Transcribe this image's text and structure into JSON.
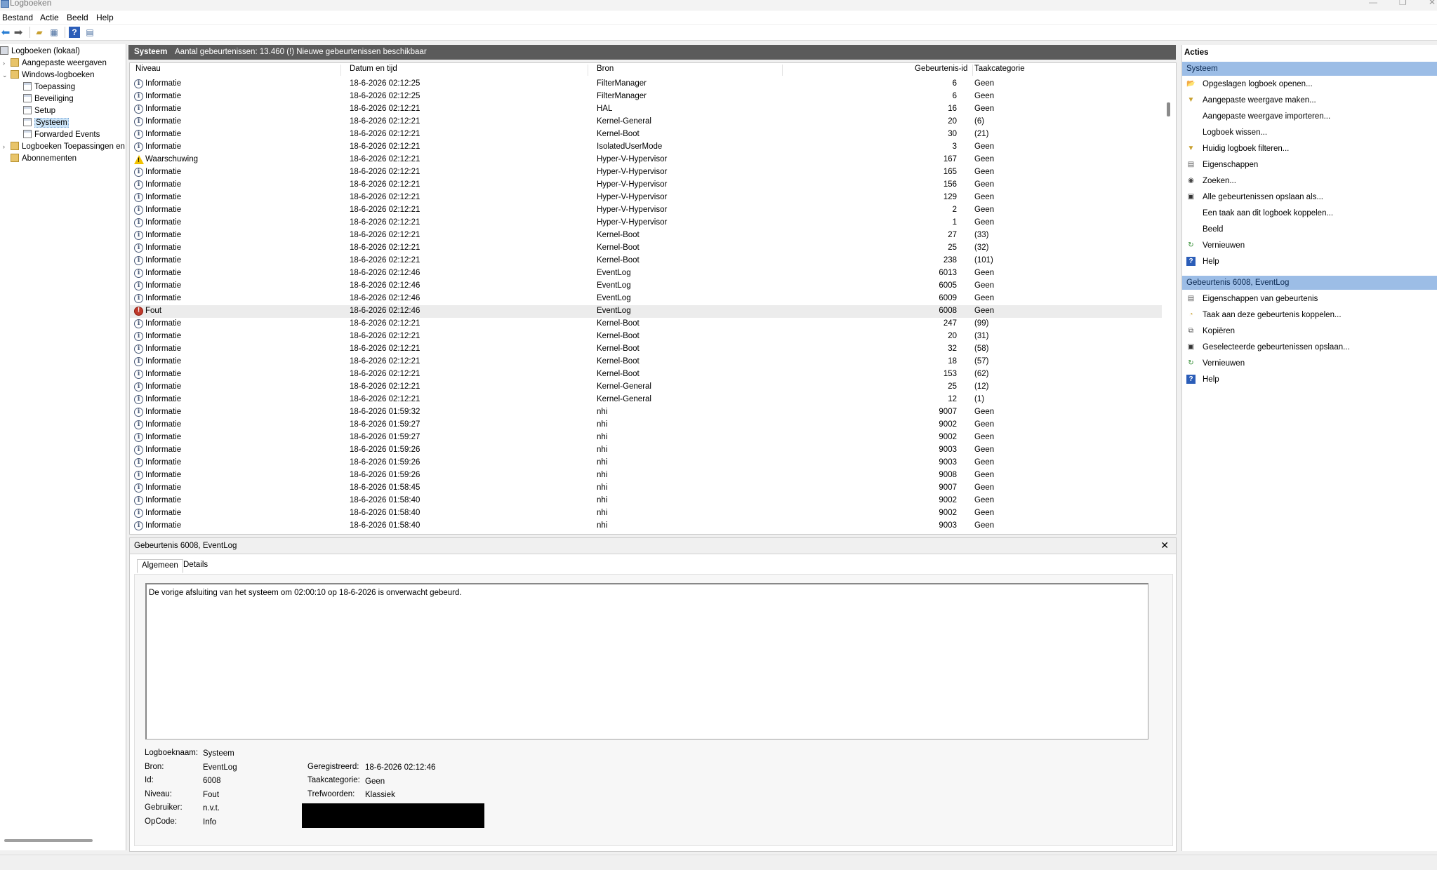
{
  "window": {
    "title": "Logboeken"
  },
  "menu": [
    "Bestand",
    "Actie",
    "Beeld",
    "Help"
  ],
  "toolbar": [
    "back-icon",
    "forward-icon",
    "up-folder-icon",
    "show-hide-tree-icon",
    "help-icon",
    "show-hide-actions-icon"
  ],
  "tree": {
    "root": "Logboeken (lokaal)",
    "custom_views": "Aangepaste weergaven",
    "windows_logs": "Windows-logboeken",
    "logs": [
      "Toepassing",
      "Beveiliging",
      "Setup",
      "Systeem",
      "Forwarded Events"
    ],
    "app_logs": "Logboeken Toepassingen en",
    "subscriptions": "Abonnementen"
  },
  "center": {
    "log_name": "Systeem",
    "count_text": "Aantal gebeurtenissen: 13.460 (!) Nieuwe gebeurtenissen beschikbaar",
    "columns": [
      "Niveau",
      "Datum en tijd",
      "Bron",
      "Gebeurtenis-id",
      "Taakcategorie"
    ]
  },
  "events": [
    {
      "level": "Informatie",
      "type": "info",
      "date": "18-6-2026 02:12:25",
      "source": "FilterManager",
      "id": "6",
      "cat": "Geen"
    },
    {
      "level": "Informatie",
      "type": "info",
      "date": "18-6-2026 02:12:25",
      "source": "FilterManager",
      "id": "6",
      "cat": "Geen"
    },
    {
      "level": "Informatie",
      "type": "info",
      "date": "18-6-2026 02:12:21",
      "source": "HAL",
      "id": "16",
      "cat": "Geen"
    },
    {
      "level": "Informatie",
      "type": "info",
      "date": "18-6-2026 02:12:21",
      "source": "Kernel-General",
      "id": "20",
      "cat": "(6)"
    },
    {
      "level": "Informatie",
      "type": "info",
      "date": "18-6-2026 02:12:21",
      "source": "Kernel-Boot",
      "id": "30",
      "cat": "(21)"
    },
    {
      "level": "Informatie",
      "type": "info",
      "date": "18-6-2026 02:12:21",
      "source": "IsolatedUserMode",
      "id": "3",
      "cat": "Geen"
    },
    {
      "level": "Waarschuwing",
      "type": "warn",
      "date": "18-6-2026 02:12:21",
      "source": "Hyper-V-Hypervisor",
      "id": "167",
      "cat": "Geen"
    },
    {
      "level": "Informatie",
      "type": "info",
      "date": "18-6-2026 02:12:21",
      "source": "Hyper-V-Hypervisor",
      "id": "165",
      "cat": "Geen"
    },
    {
      "level": "Informatie",
      "type": "info",
      "date": "18-6-2026 02:12:21",
      "source": "Hyper-V-Hypervisor",
      "id": "156",
      "cat": "Geen"
    },
    {
      "level": "Informatie",
      "type": "info",
      "date": "18-6-2026 02:12:21",
      "source": "Hyper-V-Hypervisor",
      "id": "129",
      "cat": "Geen"
    },
    {
      "level": "Informatie",
      "type": "info",
      "date": "18-6-2026 02:12:21",
      "source": "Hyper-V-Hypervisor",
      "id": "2",
      "cat": "Geen"
    },
    {
      "level": "Informatie",
      "type": "info",
      "date": "18-6-2026 02:12:21",
      "source": "Hyper-V-Hypervisor",
      "id": "1",
      "cat": "Geen"
    },
    {
      "level": "Informatie",
      "type": "info",
      "date": "18-6-2026 02:12:21",
      "source": "Kernel-Boot",
      "id": "27",
      "cat": "(33)"
    },
    {
      "level": "Informatie",
      "type": "info",
      "date": "18-6-2026 02:12:21",
      "source": "Kernel-Boot",
      "id": "25",
      "cat": "(32)"
    },
    {
      "level": "Informatie",
      "type": "info",
      "date": "18-6-2026 02:12:21",
      "source": "Kernel-Boot",
      "id": "238",
      "cat": "(101)"
    },
    {
      "level": "Informatie",
      "type": "info",
      "date": "18-6-2026 02:12:46",
      "source": "EventLog",
      "id": "6013",
      "cat": "Geen"
    },
    {
      "level": "Informatie",
      "type": "info",
      "date": "18-6-2026 02:12:46",
      "source": "EventLog",
      "id": "6005",
      "cat": "Geen"
    },
    {
      "level": "Informatie",
      "type": "info",
      "date": "18-6-2026 02:12:46",
      "source": "EventLog",
      "id": "6009",
      "cat": "Geen"
    },
    {
      "level": "Fout",
      "type": "err",
      "date": "18-6-2026 02:12:46",
      "source": "EventLog",
      "id": "6008",
      "cat": "Geen",
      "selected": true
    },
    {
      "level": "Informatie",
      "type": "info",
      "date": "18-6-2026 02:12:21",
      "source": "Kernel-Boot",
      "id": "247",
      "cat": "(99)"
    },
    {
      "level": "Informatie",
      "type": "info",
      "date": "18-6-2026 02:12:21",
      "source": "Kernel-Boot",
      "id": "20",
      "cat": "(31)"
    },
    {
      "level": "Informatie",
      "type": "info",
      "date": "18-6-2026 02:12:21",
      "source": "Kernel-Boot",
      "id": "32",
      "cat": "(58)"
    },
    {
      "level": "Informatie",
      "type": "info",
      "date": "18-6-2026 02:12:21",
      "source": "Kernel-Boot",
      "id": "18",
      "cat": "(57)"
    },
    {
      "level": "Informatie",
      "type": "info",
      "date": "18-6-2026 02:12:21",
      "source": "Kernel-Boot",
      "id": "153",
      "cat": "(62)"
    },
    {
      "level": "Informatie",
      "type": "info",
      "date": "18-6-2026 02:12:21",
      "source": "Kernel-General",
      "id": "25",
      "cat": "(12)"
    },
    {
      "level": "Informatie",
      "type": "info",
      "date": "18-6-2026 02:12:21",
      "source": "Kernel-General",
      "id": "12",
      "cat": "(1)"
    },
    {
      "level": "Informatie",
      "type": "info",
      "date": "18-6-2026 01:59:32",
      "source": "nhi",
      "id": "9007",
      "cat": "Geen"
    },
    {
      "level": "Informatie",
      "type": "info",
      "date": "18-6-2026 01:59:27",
      "source": "nhi",
      "id": "9002",
      "cat": "Geen"
    },
    {
      "level": "Informatie",
      "type": "info",
      "date": "18-6-2026 01:59:27",
      "source": "nhi",
      "id": "9002",
      "cat": "Geen"
    },
    {
      "level": "Informatie",
      "type": "info",
      "date": "18-6-2026 01:59:26",
      "source": "nhi",
      "id": "9003",
      "cat": "Geen"
    },
    {
      "level": "Informatie",
      "type": "info",
      "date": "18-6-2026 01:59:26",
      "source": "nhi",
      "id": "9003",
      "cat": "Geen"
    },
    {
      "level": "Informatie",
      "type": "info",
      "date": "18-6-2026 01:59:26",
      "source": "nhi",
      "id": "9008",
      "cat": "Geen"
    },
    {
      "level": "Informatie",
      "type": "info",
      "date": "18-6-2026 01:58:45",
      "source": "nhi",
      "id": "9007",
      "cat": "Geen"
    },
    {
      "level": "Informatie",
      "type": "info",
      "date": "18-6-2026 01:58:40",
      "source": "nhi",
      "id": "9002",
      "cat": "Geen"
    },
    {
      "level": "Informatie",
      "type": "info",
      "date": "18-6-2026 01:58:40",
      "source": "nhi",
      "id": "9002",
      "cat": "Geen"
    },
    {
      "level": "Informatie",
      "type": "info",
      "date": "18-6-2026 01:58:40",
      "source": "nhi",
      "id": "9003",
      "cat": "Geen"
    }
  ],
  "detail": {
    "title": "Gebeurtenis 6008, EventLog",
    "close": "✕",
    "tabs": [
      "Algemeen",
      "Details"
    ],
    "description": "De vorige afsluiting van het systeem om 02:00:10 op 18-6-2026 is onverwacht gebeurd.",
    "fields": {
      "logboeknaam_label": "Logboeknaam:",
      "logboeknaam": "Systeem",
      "bron_label": "Bron:",
      "bron": "EventLog",
      "id_label": "Id:",
      "id": "6008",
      "niveau_label": "Niveau:",
      "niveau": "Fout",
      "gebruiker_label": "Gebruiker:",
      "gebruiker": "n.v.t.",
      "opcode_label": "OpCode:",
      "opcode": "Info",
      "geregistreerd_label": "Geregistreerd:",
      "geregistreerd": "18-6-2026 02:12:46",
      "taakcategorie_label": "Taakcategorie:",
      "taakcategorie": "Geen",
      "trefwoorden_label": "Trefwoorden:",
      "trefwoorden": "Klassiek"
    }
  },
  "actions": {
    "title": "Acties",
    "section1": "Systeem",
    "items1": [
      {
        "label": "Opgeslagen logboek openen...",
        "icon": "folder-open-icon"
      },
      {
        "label": "Aangepaste weergave maken...",
        "icon": "filter-icon"
      },
      {
        "label": "Aangepaste weergave importeren...",
        "icon": ""
      },
      {
        "label": "Logboek wissen...",
        "icon": ""
      },
      {
        "label": "Huidig logboek filteren...",
        "icon": "filter-icon"
      },
      {
        "label": "Eigenschappen",
        "icon": "properties-icon"
      },
      {
        "label": "Zoeken...",
        "icon": "binoculars-icon"
      },
      {
        "label": "Alle gebeurtenissen opslaan als...",
        "icon": "save-icon"
      },
      {
        "label": "Een taak aan dit logboek koppelen...",
        "icon": ""
      },
      {
        "label": "Beeld",
        "icon": ""
      },
      {
        "label": "Vernieuwen",
        "icon": "refresh-icon"
      },
      {
        "label": "Help",
        "icon": "help-icon"
      }
    ],
    "section2": "Gebeurtenis 6008, EventLog",
    "items2": [
      {
        "label": "Eigenschappen van gebeurtenis",
        "icon": "properties-icon"
      },
      {
        "label": "Taak aan deze gebeurtenis koppelen...",
        "icon": "task-icon"
      },
      {
        "label": "Kopiëren",
        "icon": "copy-icon"
      },
      {
        "label": "Geselecteerde gebeurtenissen opslaan...",
        "icon": "save-icon"
      },
      {
        "label": "Vernieuwen",
        "icon": "refresh-icon"
      },
      {
        "label": "Help",
        "icon": "help-icon"
      }
    ]
  }
}
